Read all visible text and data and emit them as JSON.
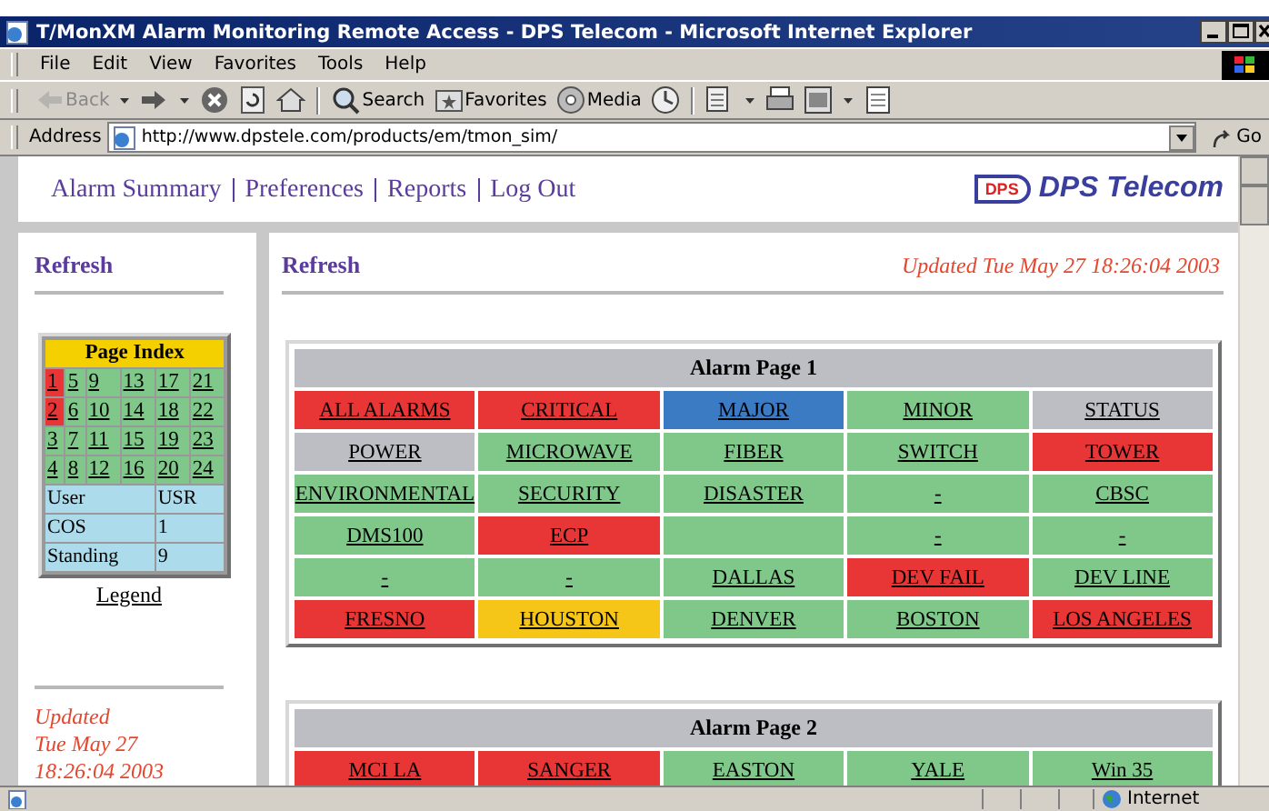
{
  "window": {
    "title": "T/MonXM Alarm Monitoring Remote Access - DPS Telecom - Microsoft Internet Explorer"
  },
  "menu": [
    "File",
    "Edit",
    "View",
    "Favorites",
    "Tools",
    "Help"
  ],
  "toolbar": [
    {
      "kind": "back",
      "label": "Back",
      "disabled": true
    },
    {
      "kind": "forward",
      "disabled": false
    },
    {
      "kind": "stop",
      "disabled": false
    },
    {
      "kind": "refresh",
      "disabled": false
    },
    {
      "kind": "home",
      "disabled": false
    },
    {
      "kind": "search",
      "label": "Search",
      "disabled": false
    },
    {
      "kind": "favorites",
      "label": "Favorites",
      "disabled": false
    },
    {
      "kind": "media",
      "label": "Media",
      "disabled": false
    },
    {
      "kind": "history",
      "disabled": false
    },
    {
      "kind": "mail",
      "disabled": false
    },
    {
      "kind": "print",
      "disabled": false
    },
    {
      "kind": "edit",
      "disabled": false
    },
    {
      "kind": "discuss",
      "disabled": false
    }
  ],
  "address": {
    "label": "Address",
    "value": "http://www.dpstele.com/products/em/tmon_sim/",
    "go": "Go"
  },
  "nav": [
    "Alarm Summary",
    "Preferences",
    "Reports",
    "Log Out"
  ],
  "logo": {
    "mark": "DPS",
    "name": "DPS Telecom"
  },
  "sidebar": {
    "refresh": "Refresh",
    "page_index": {
      "title": "Page Index",
      "pages": [
        {
          "label": "1",
          "color": "#e83535"
        },
        {
          "label": "5",
          "color": "#80c88a"
        },
        {
          "label": "9",
          "color": "#80c88a"
        },
        {
          "label": "13",
          "color": "#80c88a"
        },
        {
          "label": "17",
          "color": "#80c88a"
        },
        {
          "label": "21",
          "color": "#80c88a"
        },
        {
          "label": "2",
          "color": "#e83535"
        },
        {
          "label": "6",
          "color": "#80c88a"
        },
        {
          "label": "10",
          "color": "#80c88a"
        },
        {
          "label": "14",
          "color": "#80c88a"
        },
        {
          "label": "18",
          "color": "#80c88a"
        },
        {
          "label": "22",
          "color": "#80c88a"
        },
        {
          "label": "3",
          "color": "#80c88a"
        },
        {
          "label": "7",
          "color": "#80c88a"
        },
        {
          "label": "11",
          "color": "#80c88a"
        },
        {
          "label": "15",
          "color": "#80c88a"
        },
        {
          "label": "19",
          "color": "#80c88a"
        },
        {
          "label": "23",
          "color": "#80c88a"
        },
        {
          "label": "4",
          "color": "#80c88a"
        },
        {
          "label": "8",
          "color": "#80c88a"
        },
        {
          "label": "12",
          "color": "#80c88a"
        },
        {
          "label": "16",
          "color": "#80c88a"
        },
        {
          "label": "20",
          "color": "#80c88a"
        },
        {
          "label": "24",
          "color": "#80c88a"
        }
      ],
      "info": [
        {
          "label": "User",
          "value": "USR"
        },
        {
          "label": "COS",
          "value": "1"
        },
        {
          "label": "Standing",
          "value": "9"
        }
      ]
    },
    "legend": "Legend",
    "updated": [
      "Updated",
      "Tue May 27",
      "18:26:04 2003"
    ]
  },
  "main": {
    "refresh": "Refresh",
    "updated": "Updated Tue May 27 18:26:04 2003",
    "alarm_pages": [
      {
        "title": "Alarm Page 1",
        "cells": [
          {
            "label": "ALL ALARMS",
            "color": "#e83535"
          },
          {
            "label": "CRITICAL",
            "color": "#e83535"
          },
          {
            "label": "MAJOR",
            "color": "#3b7bc4"
          },
          {
            "label": "MINOR",
            "color": "#80c88a"
          },
          {
            "label": "STATUS",
            "color": "#bcbec4"
          },
          {
            "label": "POWER",
            "color": "#bcbec4"
          },
          {
            "label": "MICROWAVE",
            "color": "#80c88a"
          },
          {
            "label": "FIBER",
            "color": "#80c88a"
          },
          {
            "label": "SWITCH",
            "color": "#80c88a"
          },
          {
            "label": "TOWER",
            "color": "#e83535"
          },
          {
            "label": "ENVIRONMENTAL",
            "color": "#80c88a"
          },
          {
            "label": "SECURITY",
            "color": "#80c88a"
          },
          {
            "label": "DISASTER",
            "color": "#80c88a"
          },
          {
            "label": "-",
            "color": "#80c88a"
          },
          {
            "label": "CBSC",
            "color": "#80c88a"
          },
          {
            "label": "DMS100",
            "color": "#80c88a"
          },
          {
            "label": "ECP",
            "color": "#e83535"
          },
          {
            "color": "#80c88a"
          },
          {
            "label": "-",
            "color": "#80c88a"
          },
          {
            "label": "-",
            "color": "#80c88a"
          },
          {
            "label": "-",
            "color": "#80c88a"
          },
          {
            "label": "-",
            "color": "#80c88a"
          },
          {
            "label": "DALLAS",
            "color": "#80c88a"
          },
          {
            "label": "DEV FAIL",
            "color": "#e83535"
          },
          {
            "label": "DEV LINE",
            "color": "#80c88a"
          },
          {
            "label": "FRESNO",
            "color": "#e83535"
          },
          {
            "label": "HOUSTON",
            "color": "#f5c518"
          },
          {
            "label": "DENVER",
            "color": "#80c88a"
          },
          {
            "label": "BOSTON",
            "color": "#80c88a"
          },
          {
            "label": "LOS ANGELES",
            "color": "#e83535"
          }
        ]
      },
      {
        "title": "Alarm Page 2",
        "cells": [
          {
            "label": "MCI LA",
            "color": "#e83535"
          },
          {
            "label": "SANGER",
            "color": "#e83535"
          },
          {
            "label": "EASTON",
            "color": "#80c88a"
          },
          {
            "label": "YALE",
            "color": "#80c88a"
          },
          {
            "label": "Win 35",
            "color": "#80c88a"
          }
        ]
      }
    ]
  },
  "status_bar": {
    "zone": "Internet"
  }
}
